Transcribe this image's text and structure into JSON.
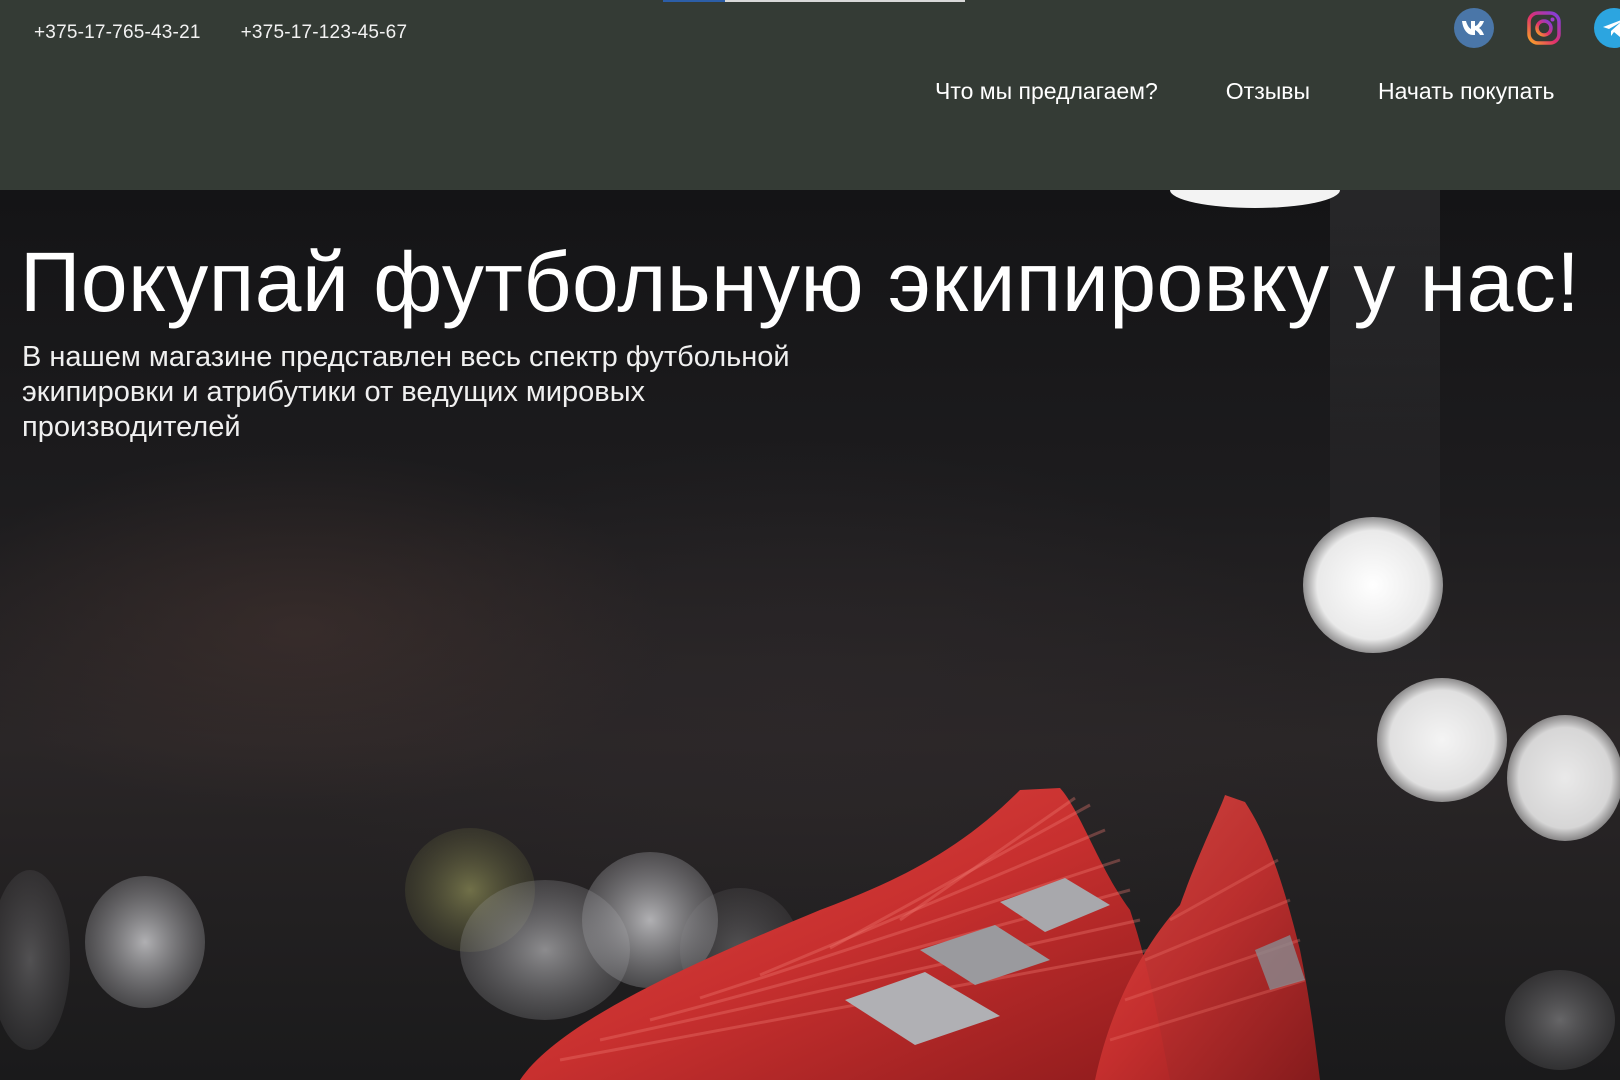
{
  "header": {
    "phones": [
      "+375-17-765-43-21",
      "+375-17-123-45-67"
    ],
    "socials": [
      {
        "name": "vk",
        "icon": "vk-icon",
        "color": "#4a76a8"
      },
      {
        "name": "instagram",
        "icon": "instagram-icon",
        "color": "#c13584"
      },
      {
        "name": "telegram",
        "icon": "telegram-icon",
        "color": "#2ca5e0"
      }
    ],
    "nav": [
      {
        "label": "Что мы предлагаем?"
      },
      {
        "label": "Отзывы"
      },
      {
        "label": "Начать покупать"
      }
    ],
    "background": "#343b35"
  },
  "hero": {
    "title": "Покупай футбольную экипировку у нас!",
    "description": "В нашем магазине представлен весь спектр футбольной экипировки и атрибутики от ведущих мировых производителей",
    "image_subject": "red football boots on dark bokeh background",
    "accent": "#c62f2f"
  }
}
